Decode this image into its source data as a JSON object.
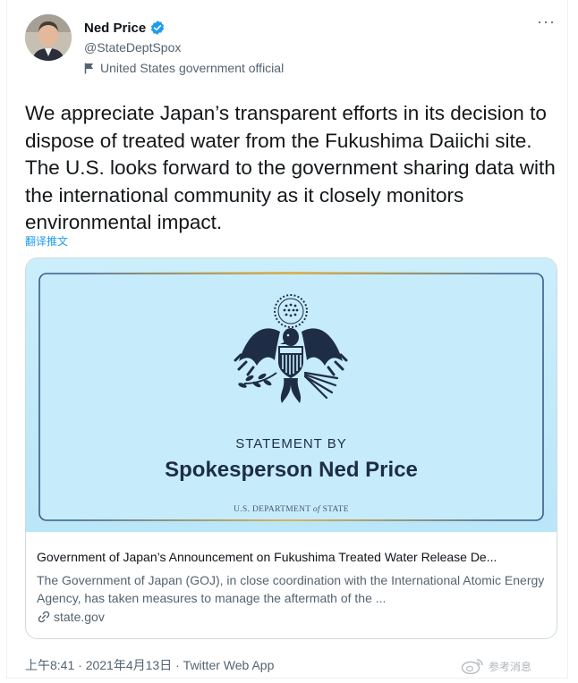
{
  "author": {
    "name": "Ned Price",
    "handle": "@StateDeptSpox",
    "label": "United States government official",
    "verified": true
  },
  "icons": {
    "verified": "verified-badge-icon",
    "official": "flag-icon",
    "more": "more-icon",
    "link": "link-icon",
    "watermark": "weibo-icon"
  },
  "tweet": {
    "text": "We appreciate Japan’s transparent efforts in its decision to dispose of treated water from the Fukushima Daiichi site. The U.S. looks forward to the government sharing data with the international community as it closely monitors environmental impact.",
    "translate_label": "翻译推文"
  },
  "card": {
    "image": {
      "statement_by": "STATEMENT BY",
      "speaker": "Spokesperson Ned Price",
      "department_prefix": "U.S. DEPARTMENT",
      "department_of": "of",
      "department_suffix": "STATE"
    },
    "title": "Government of Japan’s Announcement on Fukushima Treated Water Release De...",
    "description": "The Government of Japan (GOJ), in close coordination with the International Atomic Energy Agency, has taken measures to manage the aftermath of the ...",
    "domain": "state.gov"
  },
  "meta": {
    "time": "上午8:41",
    "date": "2021年4月13日",
    "app": "Twitter Web App"
  },
  "watermark": {
    "text": "参考消息"
  },
  "colors": {
    "accent": "#1d9bf0",
    "card_bg": "#c4eafa",
    "emblem": "#1e2d45",
    "gold": "#d9b45a"
  }
}
